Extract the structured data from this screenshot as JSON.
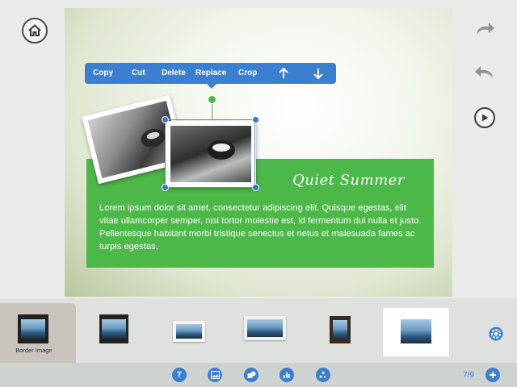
{
  "colors": {
    "accent": "#3a7fd0",
    "green_panel": "#4cb848",
    "rotate_handle": "#4cb848"
  },
  "slide": {
    "title": "Quiet Summer",
    "body": "Lorem ipsum dolor sit amet, consectetur adipiscing elit. Quisque egestas, elit vitae ullamcorper semper, nisi tortor molestie est, id fermentum dui nulla et justo. Pellentesque habitant morbi tristique senectus et netus et malesuada fames ac turpis egestas."
  },
  "context_menu": {
    "copy": "Copy",
    "cut": "Cut",
    "delete": "Delete",
    "replace": "Replace",
    "crop": "Crop",
    "up_icon": "arrow-up-icon",
    "down_icon": "arrow-down-icon"
  },
  "nav": {
    "home_icon": "home-icon",
    "redo_icon": "redo-icon",
    "undo_icon": "undo-icon",
    "play_icon": "play-icon"
  },
  "thumbnails": {
    "active_label": "Border Image",
    "items": [
      "film-border",
      "film-border-2",
      "torn-paper",
      "pinned-photo",
      "dark-frame",
      "white-border"
    ]
  },
  "toolbar": {
    "tools": [
      "text-tool-icon",
      "image-tool-icon",
      "shape-tool-icon",
      "chart-tool-icon",
      "effects-tool-icon"
    ],
    "text_tool_label": "T",
    "page_counter": "7/9",
    "add_icon": "plus-icon"
  }
}
